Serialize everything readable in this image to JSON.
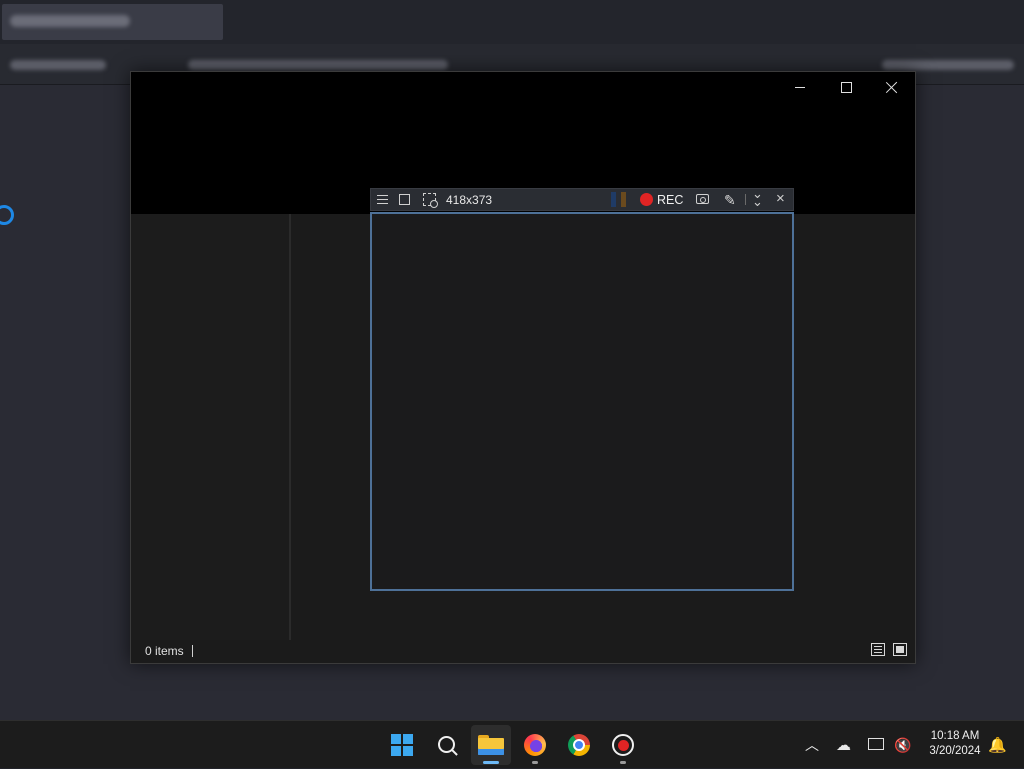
{
  "explorer": {
    "status_items": "0 items"
  },
  "capture_toolbar": {
    "size": "418x373",
    "rec_label": "REC",
    "colors": {
      "record": "#e02424",
      "frame": "#4e7198",
      "swatch_1": "#1f3b66",
      "swatch_2": "#6a4a1e"
    }
  },
  "taskbar": {
    "apps": [
      "start-icon",
      "search-icon",
      "file-explorer-icon",
      "firefox-icon",
      "chrome-icon",
      "screen-recorder-icon"
    ],
    "time": "10:18 AM",
    "date": "3/20/2024",
    "accent": "#3ca8f0"
  }
}
